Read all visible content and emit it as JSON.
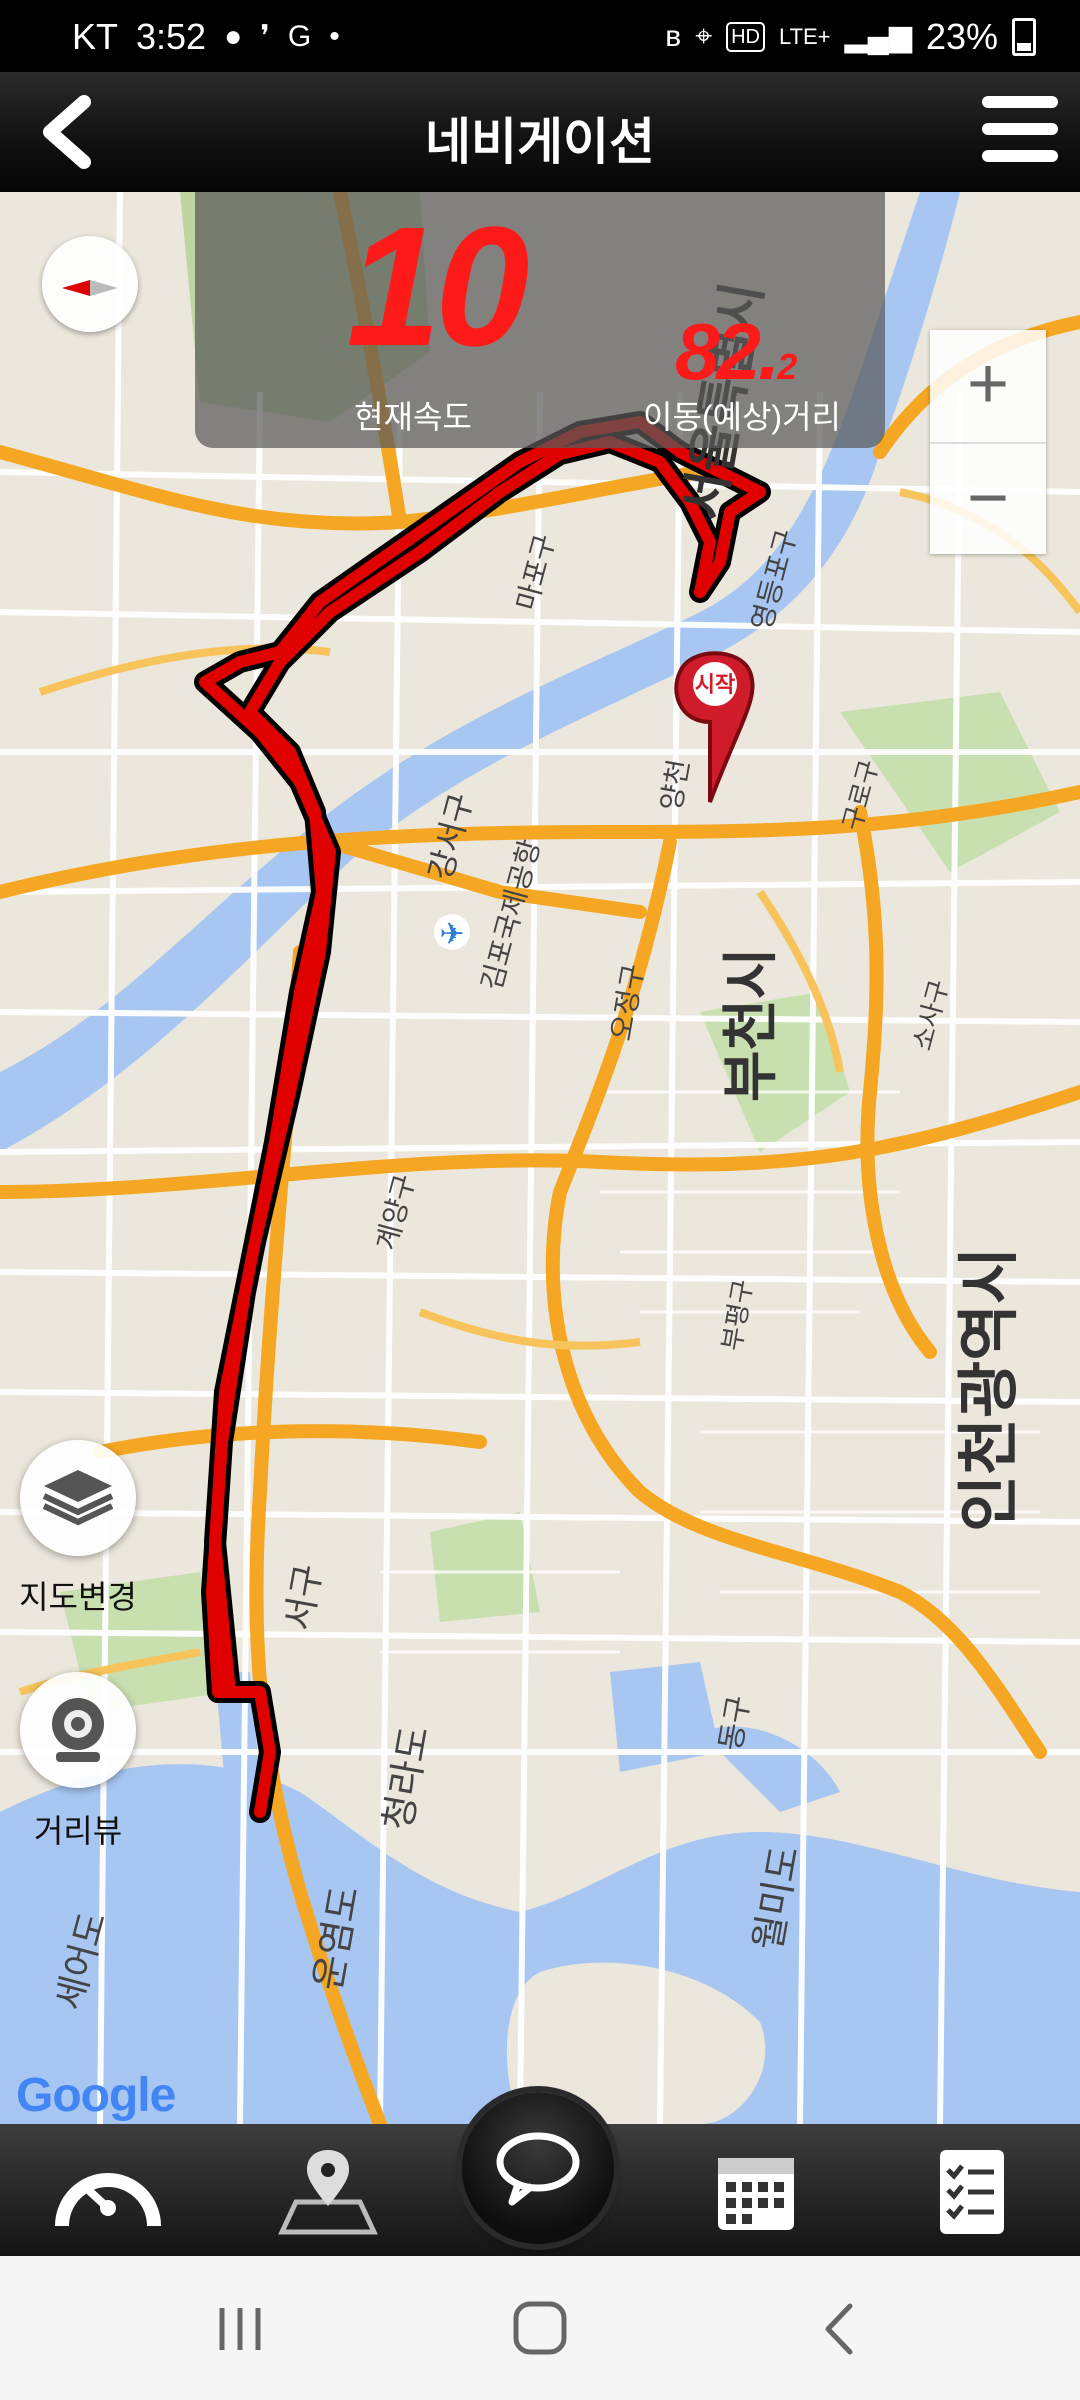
{
  "status_bar": {
    "carrier": "KT",
    "time": "3:52",
    "network": "LTE+",
    "battery": "23%"
  },
  "header": {
    "title": "네비게이션"
  },
  "speed_panel": {
    "current_speed": "10",
    "current_speed_label": "현재속도",
    "distance": "82.",
    "distance_decimal": "2",
    "distance_label": "이동(예상)거리"
  },
  "map": {
    "labels": {
      "seoul": "서울특별시",
      "bucheon": "부천시",
      "incheon": "인천광역시",
      "gimpo_airport": "김포국제공항",
      "gangseo": "강서구",
      "mapo": "마포구",
      "yeongdeungpo": "영등포구",
      "gyeyang": "계양구",
      "bupyeong": "부평구",
      "seo_gu": "서구",
      "dong_gu": "동구",
      "cheongna": "청라도",
      "wolmido": "월미도",
      "unyeom": "운염도",
      "seeo": "세어도",
      "yangcheon": "양천",
      "ojeong": "오정구",
      "gyeonggi_guro": "구로구",
      "sosa": "소사구",
      "start_marker": "시작"
    },
    "buttons": {
      "change_map": "지도변경",
      "street_view": "거리뷰"
    },
    "google": "Google"
  },
  "colors": {
    "route": "#e00000",
    "highway": "#f5a623",
    "water": "#a7c6f2",
    "land": "#ebe7dc",
    "park": "#c8dfb0"
  }
}
